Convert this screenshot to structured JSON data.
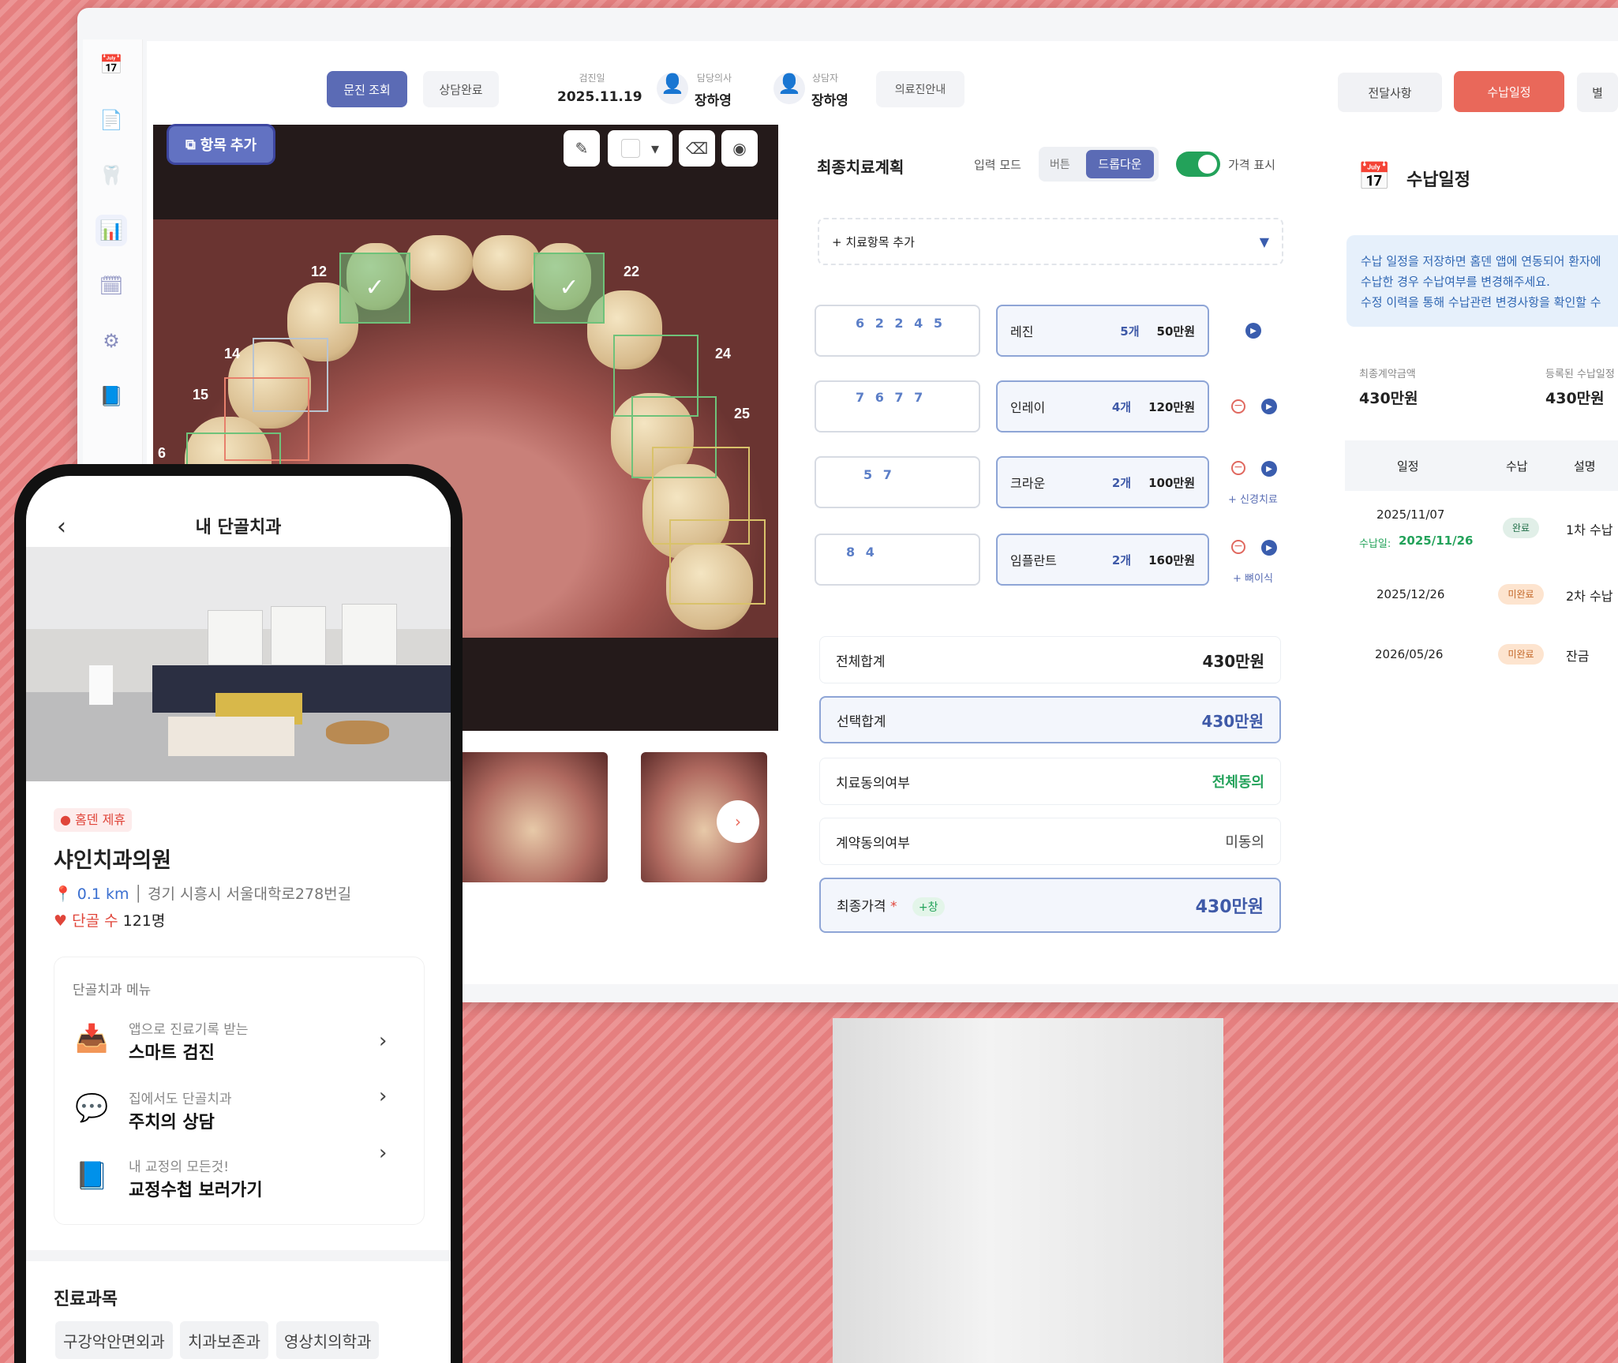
{
  "topbar": {
    "lookup": "문진 조회",
    "consult_done": "상담완료",
    "exam_date_label": "검진일",
    "exam_date": "2025.11.19",
    "doctor_label": "담당의사",
    "doctor": "장하영",
    "counselor_label": "상담자",
    "counselor": "장하영",
    "info": "의료진안내",
    "notice": "전달사항",
    "payment_schedule": "수납일정"
  },
  "viewer": {
    "add_item": "항목 추가",
    "teeth": [
      "12",
      "22",
      "14",
      "24",
      "15",
      "25",
      "6"
    ]
  },
  "plan": {
    "title": "최종치료계획",
    "input_mode": "입력 모드",
    "mode_button": "버튼",
    "mode_dropdown": "드롭다운",
    "price_display": "가격 표시",
    "add_treatment": "+ 치료항목 추가",
    "rows": [
      {
        "teeth": "6  2  2 4 5",
        "name": "레진",
        "count": "5개",
        "price": "50만원"
      },
      {
        "teeth": "7  6 7  7",
        "name": "인레이",
        "count": "4개",
        "price": "120만원"
      },
      {
        "teeth": "5  7",
        "name": "크라운",
        "count": "2개",
        "price": "100만원",
        "extra": "+ 신경치료"
      },
      {
        "teeth": "8  4",
        "name": "임플란트",
        "count": "2개",
        "price": "160만원",
        "extra": "+ 뼈이식"
      }
    ],
    "total_label": "전체합계",
    "total": "430만원",
    "selected_label": "선택합계",
    "selected": "430만원",
    "consent_label": "치료동의여부",
    "consent": "전체동의",
    "contract_label": "계약동의여부",
    "contract": "미동의",
    "final_label": "최종가격",
    "final_star": "*",
    "final_adjust": "+창",
    "final": "430만원"
  },
  "payment": {
    "title": "수납일정",
    "notice": [
      "수납 일정을 저장하면 홈덴 앱에 연동되어 환자에",
      "수납한 경우 수납여부를 변경해주세요.",
      "수정 이력을 통해 수납관련 변경사항을 확인할 수"
    ],
    "contract_amount_label": "최종계약금액",
    "contract_amount": "430만원",
    "registered_label": "등록된 수납일정",
    "registered": "430만원",
    "col_date": "일정",
    "col_pay": "수납",
    "col_desc": "설명",
    "rows": [
      {
        "date": "2025/11/07",
        "paid_label": "수납일:",
        "paid_date": "2025/11/26",
        "status": "완료",
        "desc": "1차 수납"
      },
      {
        "date": "2025/12/26",
        "status": "미완료",
        "desc": "2차 수납"
      },
      {
        "date": "2026/05/26",
        "status": "미완료",
        "desc": "잔금"
      }
    ]
  },
  "phone": {
    "title": "내 단골치과",
    "badge": "홈덴 제휴",
    "clinic": "샤인치과의원",
    "distance": "0.1 km",
    "address": "경기 시흥시 서울대학로278번길",
    "fans_label": "단골 수",
    "fans": "121명",
    "menu_title": "단골치과 메뉴",
    "menu": [
      {
        "sub": "앱으로 진료기록 받는",
        "title": "스마트 검진"
      },
      {
        "sub": "집에서도 단골치과",
        "title": "주치의 상담"
      },
      {
        "sub": "내 교정의 모든것!",
        "title": "교정수첩 보러가기"
      }
    ],
    "dept_title": "진료과목",
    "depts": [
      "구강악안면외과",
      "치과보존과",
      "영상치의학과"
    ]
  },
  "colors": {
    "accent": "#5566b8",
    "orange": "#e9685a",
    "green": "#2aa15a"
  }
}
